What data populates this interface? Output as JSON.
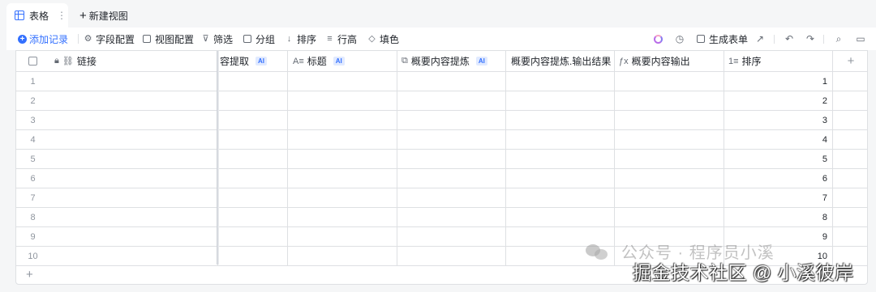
{
  "tabs": {
    "active_label": "表格",
    "new_view_label": "新建视图"
  },
  "toolbar": {
    "add_record": "添加记录",
    "field_config": "字段配置",
    "view_config": "视图配置",
    "filter": "筛选",
    "group": "分组",
    "sort": "排序",
    "row_height": "行高",
    "fill_color": "填色",
    "generate_form": "生成表单"
  },
  "grid": {
    "ai_badge": "AI",
    "columns": [
      {
        "label": "链接",
        "icon": "link-icon"
      },
      {
        "label": "容提取",
        "icon": "",
        "ai": true
      },
      {
        "label": "标题",
        "icon": "text-icon",
        "ai": true
      },
      {
        "label": "概要内容提炼",
        "icon": "copy-icon",
        "ai": true
      },
      {
        "label": "概要内容提炼.输出结果",
        "icon": ""
      },
      {
        "label": "概要内容输出",
        "icon": "formula-icon"
      },
      {
        "label": "排序",
        "icon": "number-icon"
      }
    ],
    "rows": [
      {
        "n": "1",
        "sort": "1"
      },
      {
        "n": "2",
        "sort": "2"
      },
      {
        "n": "3",
        "sort": "3"
      },
      {
        "n": "4",
        "sort": "4"
      },
      {
        "n": "5",
        "sort": "5"
      },
      {
        "n": "6",
        "sort": "6"
      },
      {
        "n": "7",
        "sort": "7"
      },
      {
        "n": "8",
        "sort": "8"
      },
      {
        "n": "9",
        "sort": "9"
      },
      {
        "n": "10",
        "sort": "10"
      }
    ]
  },
  "watermark": {
    "line1": "公众号 · 程序员小溪",
    "line2": "掘金技术社区 @ 小溪彼岸"
  },
  "colors": {
    "accent": "#3370ff",
    "border": "#dee0e3"
  }
}
